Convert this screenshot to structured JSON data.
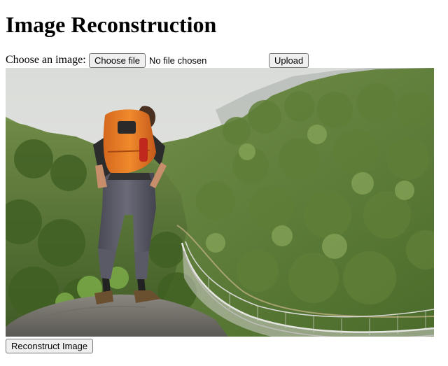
{
  "page": {
    "title": "Image Reconstruction"
  },
  "upload_form": {
    "label": "Choose an image:",
    "choose_button": "Choose file",
    "file_status": "No file chosen",
    "upload_button": "Upload"
  },
  "image": {
    "alt": "Hiker with orange backpack standing on a rock overlooking a forested valley with a suspension bridge"
  },
  "actions": {
    "reconstruct_button": "Reconstruct Image"
  }
}
